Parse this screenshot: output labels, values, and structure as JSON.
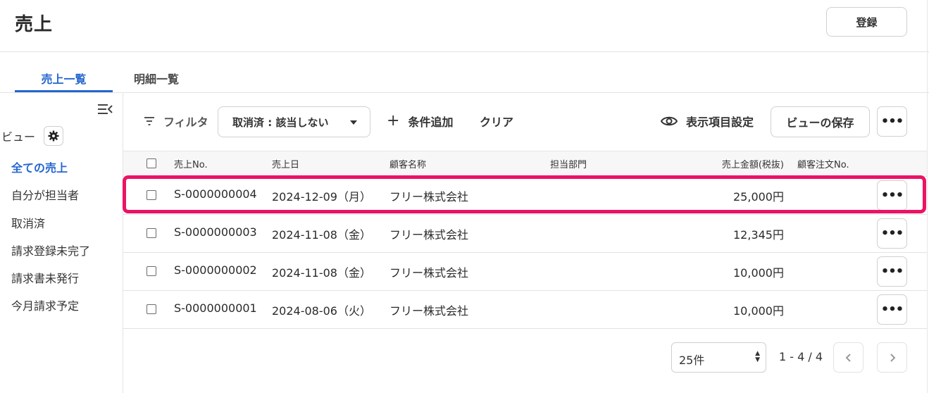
{
  "header": {
    "title": "売上",
    "register_label": "登録"
  },
  "tabs": [
    {
      "label": "売上一覧",
      "active": true
    },
    {
      "label": "明細一覧",
      "active": false
    }
  ],
  "sidebar": {
    "view_label": "ビュー",
    "items": [
      {
        "label": "全ての売上",
        "active": true
      },
      {
        "label": "自分が担当者",
        "active": false
      },
      {
        "label": "取消済",
        "active": false
      },
      {
        "label": "請求登録未完了",
        "active": false
      },
      {
        "label": "請求書未発行",
        "active": false
      },
      {
        "label": "今月請求予定",
        "active": false
      }
    ]
  },
  "toolbar": {
    "filter_label": "フィルタ",
    "filter_value": "取消済 : 該当しない",
    "add_condition_label": "条件追加",
    "clear_label": "クリア",
    "display_settings_label": "表示項目設定",
    "save_view_label": "ビューの保存"
  },
  "table": {
    "columns": [
      "売上No.",
      "売上日",
      "顧客名称",
      "担当部門",
      "売上金額(税抜)",
      "顧客注文No."
    ],
    "rows": [
      {
        "no": "S-0000000004",
        "date": "2024-12-09（月）",
        "customer": "フリー株式会社",
        "department": "",
        "amount": "25,000円",
        "order_no": "",
        "highlighted": true
      },
      {
        "no": "S-0000000003",
        "date": "2024-11-08（金）",
        "customer": "フリー株式会社",
        "department": "",
        "amount": "12,345円",
        "order_no": "",
        "highlighted": false
      },
      {
        "no": "S-0000000002",
        "date": "2024-11-08（金）",
        "customer": "フリー株式会社",
        "department": "",
        "amount": "10,000円",
        "order_no": "",
        "highlighted": false
      },
      {
        "no": "S-0000000001",
        "date": "2024-08-06（火）",
        "customer": "フリー株式会社",
        "department": "",
        "amount": "10,000円",
        "order_no": "",
        "highlighted": false
      }
    ]
  },
  "pagination": {
    "per_page": "25件",
    "range": "1 - 4 / 4"
  },
  "colors": {
    "accent": "#2566d0",
    "highlight": "#ec1265"
  },
  "icons": {
    "collapse": "sidebar-collapse-icon",
    "gear": "gear-icon",
    "filter": "filter-icon",
    "eye": "eye-icon",
    "more": "more-horizontal-icon",
    "prev": "chevron-left-icon",
    "next": "chevron-right-icon"
  }
}
